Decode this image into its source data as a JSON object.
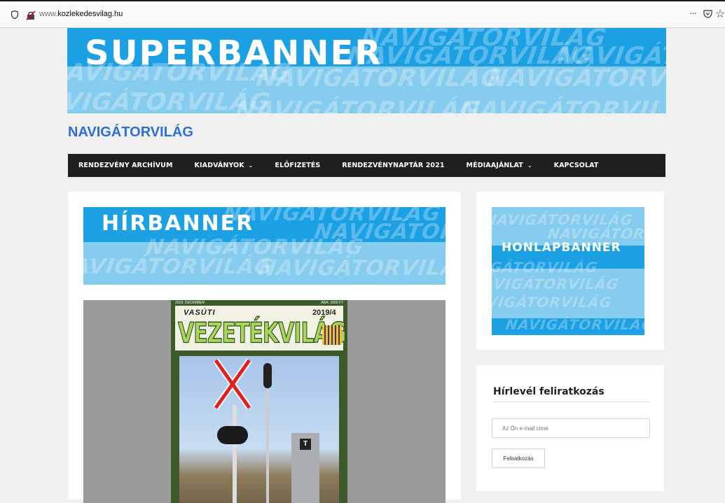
{
  "browser": {
    "url_prefix": "www.",
    "url_domain": "kozlekedesvilag.hu",
    "more_label": "···",
    "star_label": "☆"
  },
  "banners": {
    "superbanner": "SUPERBANNER",
    "hirbanner": "HÍRBANNER",
    "honlapbanner": "HONLAPBANNER",
    "watermark": "NAVIGÁTORVILÁG"
  },
  "site": {
    "title": "NAVIGÁTORVILÁG"
  },
  "nav": {
    "items": [
      {
        "label": "RENDEZVÉNY ARCHÍVUM",
        "chev": ""
      },
      {
        "label": "KIADVÁNYOK",
        "chev": "⌄"
      },
      {
        "label": "ELŐFIZETÉS",
        "chev": ""
      },
      {
        "label": "RENDEZVÉNYNAPTÁR 2021",
        "chev": ""
      },
      {
        "label": "MÉDIAAJÁNLAT",
        "chev": "⌄"
      },
      {
        "label": "KAPCSOLAT",
        "chev": ""
      }
    ]
  },
  "cover": {
    "top_left": "2019. DECEMBER",
    "top_right": "ÁRA: 1600 FT",
    "vasuti": "VASÚTI",
    "year": "2019/4",
    "title": "VEZETÉKVILÁG",
    "box_letter": "T"
  },
  "newsletter": {
    "title": "Hírlevél feliratkozás",
    "email_placeholder": "Az Ön e-mail címe",
    "submit_label": "Feliratkozás"
  },
  "colors": {
    "accent": "#2d6fd6",
    "nav_bg": "#1f1f1f",
    "banner_blue": "#1aa0e3",
    "banner_light": "#86ccee"
  }
}
